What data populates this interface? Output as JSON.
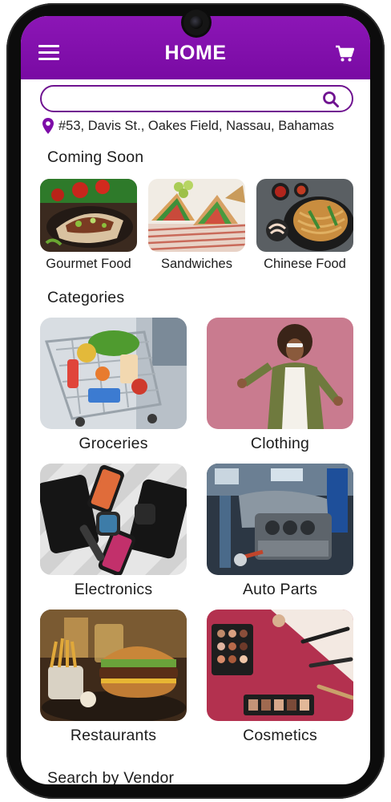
{
  "header": {
    "title": "HOME",
    "menu_icon": "hamburger-menu-icon",
    "cart_icon": "shopping-cart-icon"
  },
  "colors": {
    "brand": "#7d0ca8",
    "search_border": "#6f1390"
  },
  "search": {
    "placeholder": "",
    "value": ""
  },
  "address": {
    "text": "#53, Davis St., Oakes Field, Nassau, Bahamas"
  },
  "coming_soon": {
    "title": "Coming Soon",
    "items": [
      {
        "label": "Gourmet Food"
      },
      {
        "label": "Sandwiches"
      },
      {
        "label": "Chinese Food"
      }
    ]
  },
  "categories": {
    "title": "Categories",
    "items": [
      {
        "label": "Groceries"
      },
      {
        "label": "Clothing"
      },
      {
        "label": "Electronics"
      },
      {
        "label": "Auto Parts"
      },
      {
        "label": "Restaurants"
      },
      {
        "label": "Cosmetics"
      }
    ]
  },
  "search_by_vendor": {
    "title": "Search by Vendor"
  }
}
